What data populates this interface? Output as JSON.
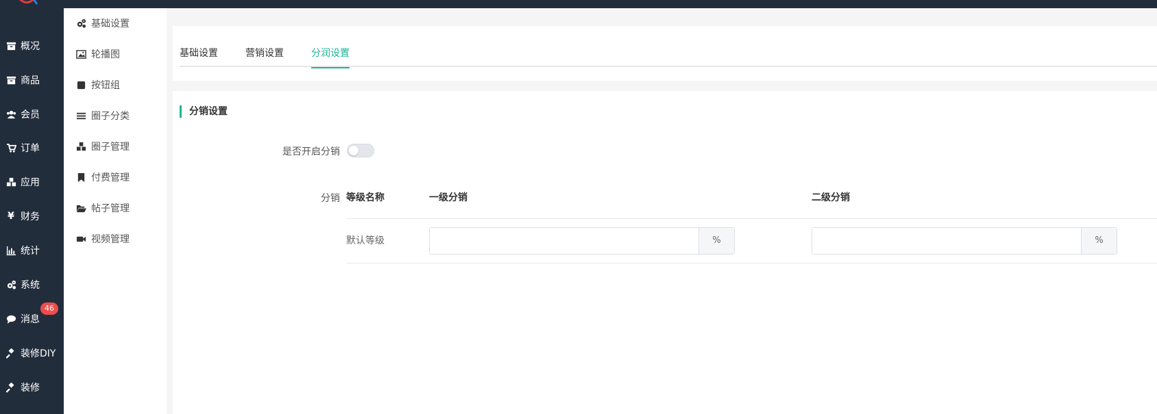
{
  "rail": {
    "items": [
      {
        "label": "概况",
        "icon": "archive-icon"
      },
      {
        "label": "商品",
        "icon": "archive-icon"
      },
      {
        "label": "会员",
        "icon": "users-icon"
      },
      {
        "label": "订单",
        "icon": "cart-icon"
      },
      {
        "label": "应用",
        "icon": "cubes-icon"
      },
      {
        "label": "财务",
        "icon": "yen-icon"
      },
      {
        "label": "统计",
        "icon": "bar-chart-icon"
      },
      {
        "label": "系统",
        "icon": "gears-icon"
      },
      {
        "label": "消息",
        "icon": "comment-icon"
      },
      {
        "label": "装修DIY",
        "icon": "gavel-icon"
      },
      {
        "label": "装修",
        "icon": "gavel-icon"
      }
    ],
    "message_badge": "46"
  },
  "subnav": {
    "items": [
      {
        "label": "基础设置",
        "icon": "gears-icon"
      },
      {
        "label": "轮播图",
        "icon": "image-icon"
      },
      {
        "label": "按钮组",
        "icon": "square-icon"
      },
      {
        "label": "圈子分类",
        "icon": "list-icon"
      },
      {
        "label": "圈子管理",
        "icon": "cubes-icon"
      },
      {
        "label": "付费管理",
        "icon": "bookmark-icon"
      },
      {
        "label": "帖子管理",
        "icon": "folder-open-icon"
      },
      {
        "label": "视频管理",
        "icon": "video-icon"
      }
    ]
  },
  "tabs": [
    {
      "label": "基础设置",
      "active": false
    },
    {
      "label": "营销设置",
      "active": false
    },
    {
      "label": "分润设置",
      "active": true
    }
  ],
  "settings": {
    "section_title": "分销设置",
    "enable_label": "是否开启分销",
    "enable_value": false,
    "distribution_label": "分销",
    "table": {
      "headers": [
        "等级名称",
        "一级分销",
        "二级分销"
      ],
      "rows": [
        {
          "name": "默认等级",
          "level1": "",
          "level2": "",
          "suffix": "%"
        }
      ]
    }
  },
  "colors": {
    "accent": "#21b497",
    "rail_bg": "#222d3c",
    "badge": "#ed4d4d"
  }
}
